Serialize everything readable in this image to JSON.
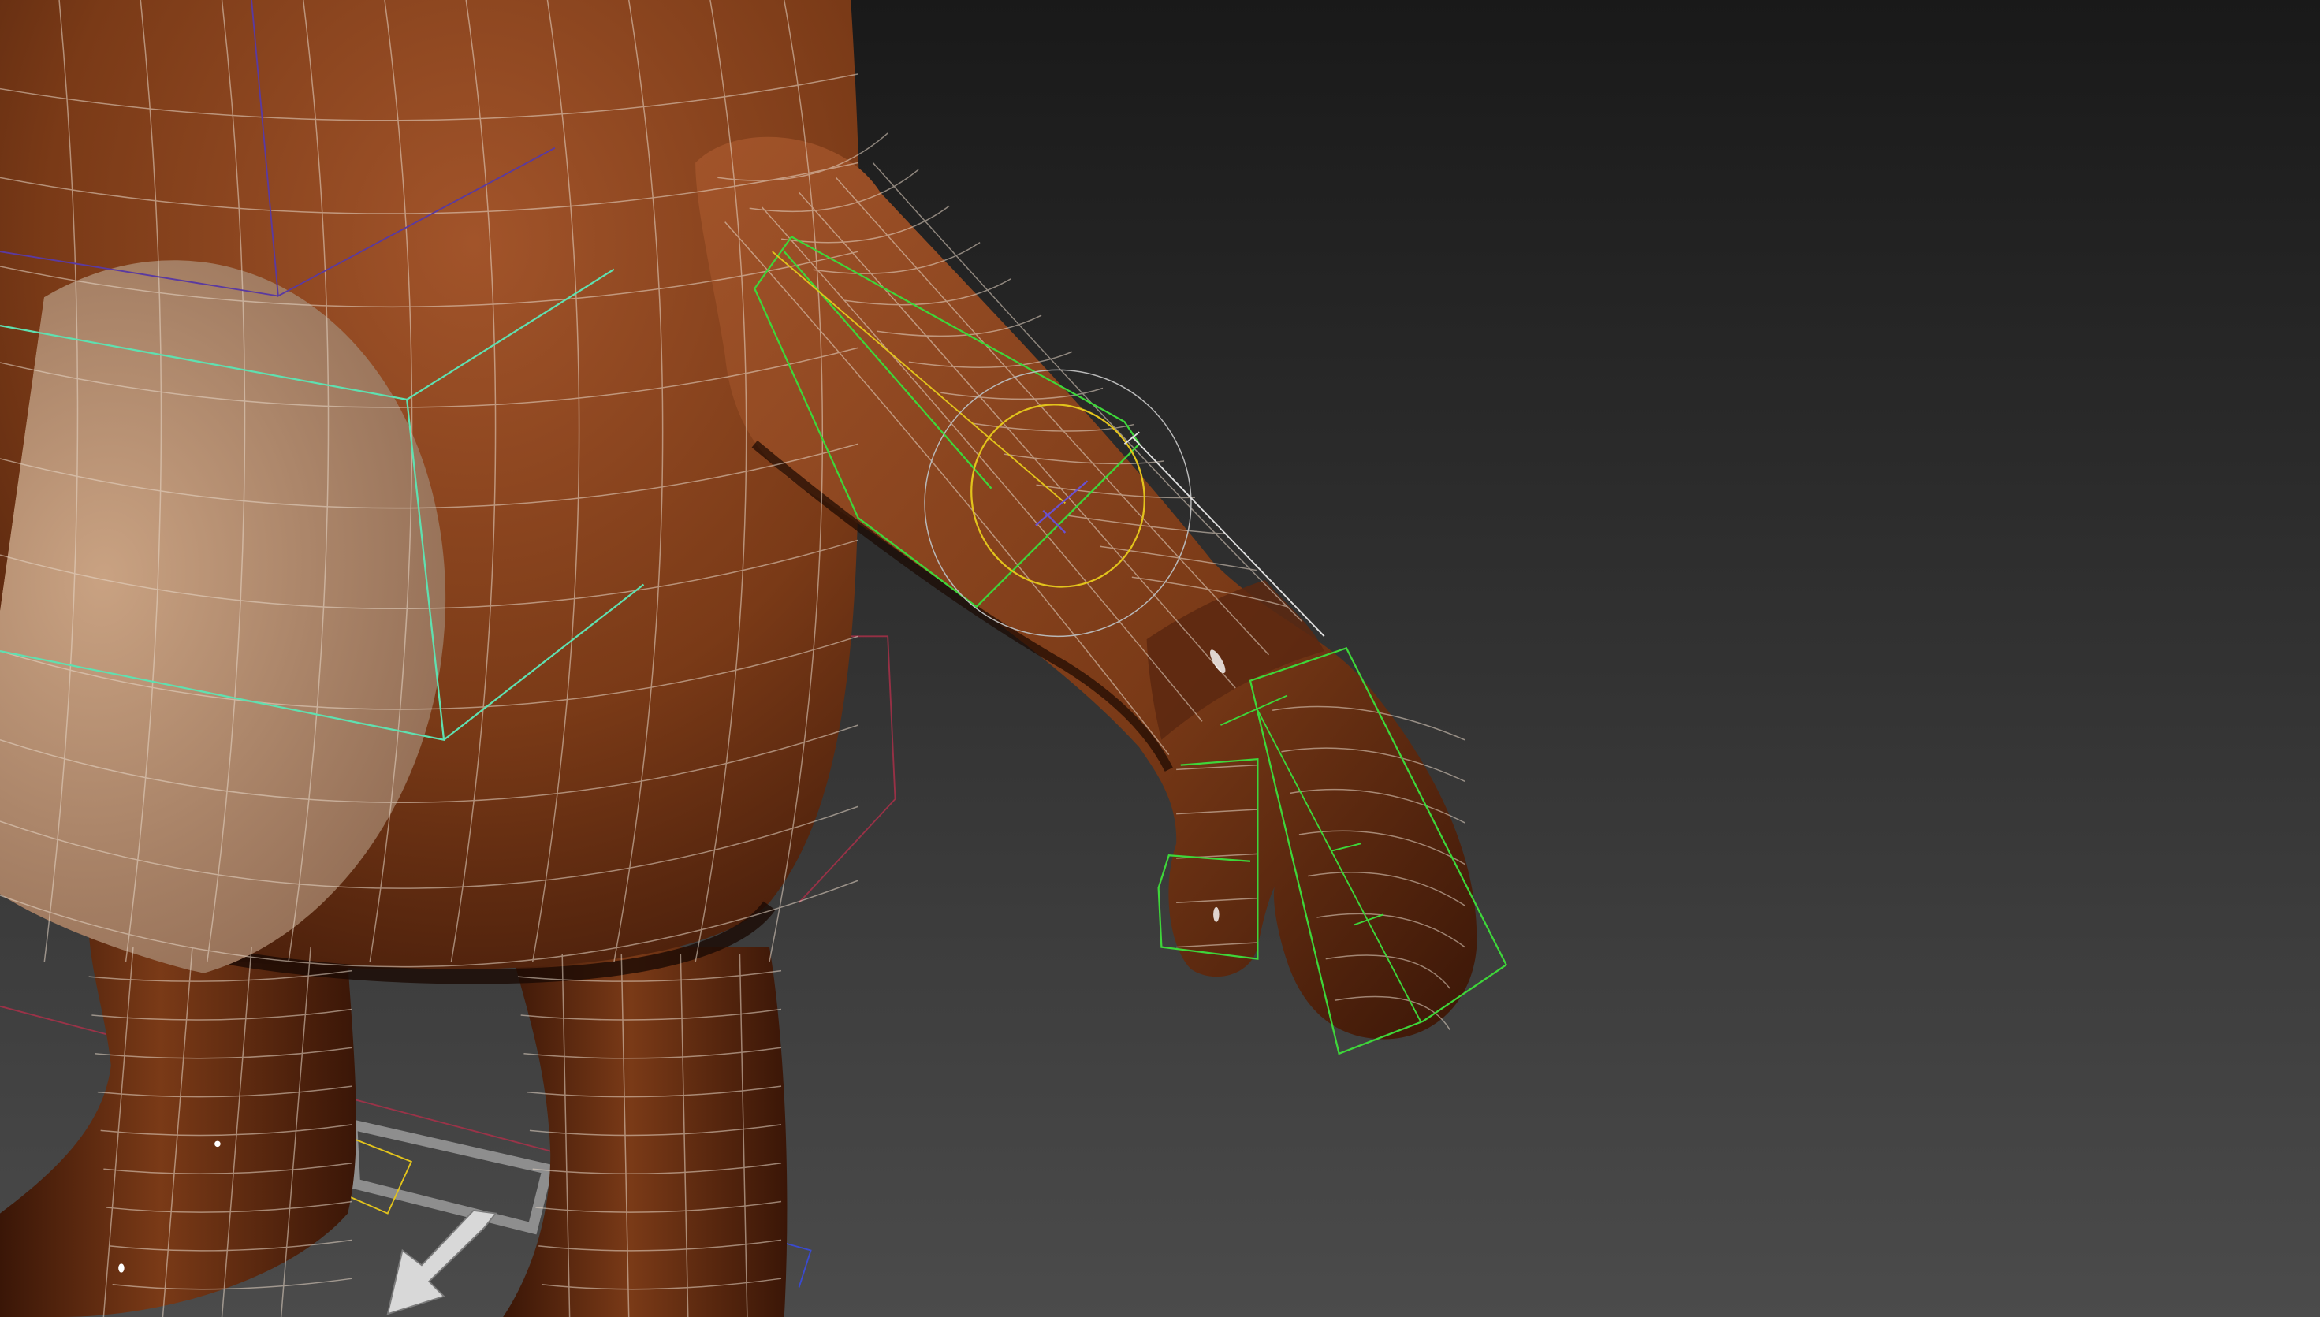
{
  "viewport": {
    "mode": "perspective",
    "display": "smooth-shaded-with-wireframe",
    "colors": {
      "background_top": "#191919",
      "background_bottom": "#4b4b4b",
      "skin": "#7a3a17",
      "skin_highlight": "#a2542a",
      "skin_shadow": "#3a1607",
      "belly": "#c9a282",
      "belly_shadow": "#8f6a52",
      "wire": "#e8d8c8",
      "bone_green": "#3ed63a",
      "bone_teal": "#5fe0b0",
      "control_yellow": "#e2c31c",
      "control_grey": "#b8b8b8",
      "helper_red": "#b0304a",
      "helper_purple": "#5a3aa0",
      "ground_grey": "#8e8e8e"
    }
  },
  "scene": {
    "objects": [
      {
        "name": "character-body",
        "icon": "mesh-icon",
        "selected": false
      },
      {
        "name": "arm-bone-chain",
        "icon": "bone-icon",
        "selected": true
      },
      {
        "name": "wrist-control",
        "icon": "circle-control-icon",
        "selected": true
      },
      {
        "name": "finger-bones",
        "icon": "bone-icon",
        "selected": false
      },
      {
        "name": "foot-control-arrow",
        "icon": "arrow-icon",
        "selected": false
      }
    ]
  }
}
